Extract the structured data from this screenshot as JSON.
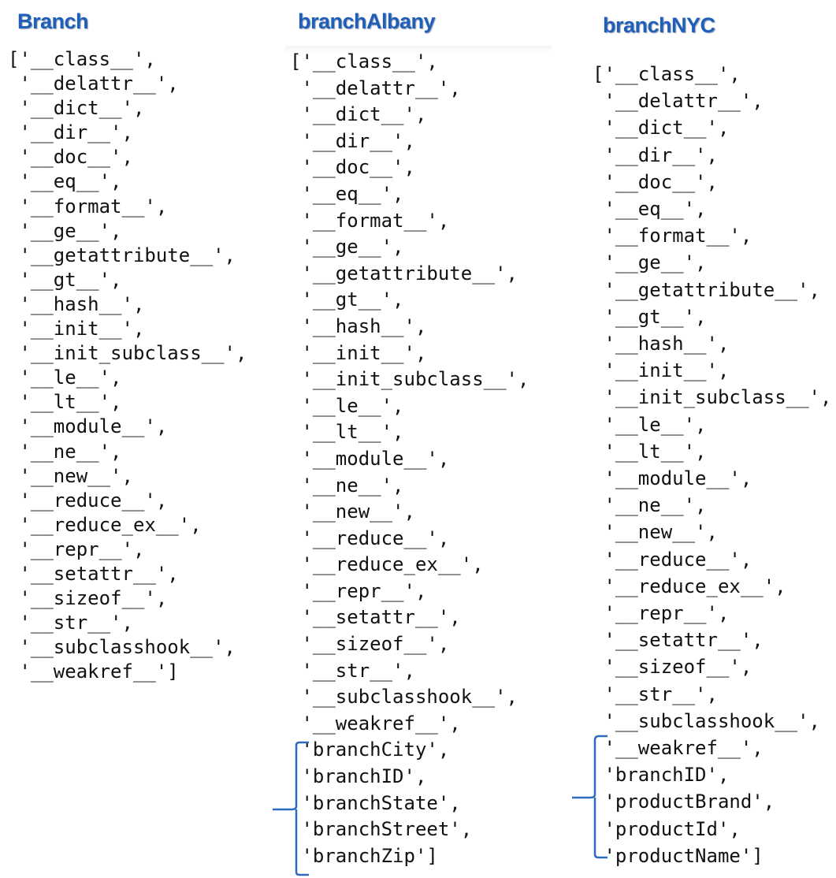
{
  "columns": [
    {
      "title": "Branch",
      "lines": [
        "['__class__',",
        " '__delattr__',",
        " '__dict__',",
        " '__dir__',",
        " '__doc__',",
        " '__eq__',",
        " '__format__',",
        " '__ge__',",
        " '__getattribute__',",
        " '__gt__',",
        " '__hash__',",
        " '__init__',",
        " '__init_subclass__',",
        " '__le__',",
        " '__lt__',",
        " '__module__',",
        " '__ne__',",
        " '__new__',",
        " '__reduce__',",
        " '__reduce_ex__',",
        " '__repr__',",
        " '__setattr__',",
        " '__sizeof__',",
        " '__str__',",
        " '__subclasshook__',",
        " '__weakref__']"
      ]
    },
    {
      "title": "branchAlbany",
      "lines": [
        "['__class__',",
        " '__delattr__',",
        " '__dict__',",
        " '__dir__',",
        " '__doc__',",
        " '__eq__',",
        " '__format__',",
        " '__ge__',",
        " '__getattribute__',",
        " '__gt__',",
        " '__hash__',",
        " '__init__',",
        " '__init_subclass__',",
        " '__le__',",
        " '__lt__',",
        " '__module__',",
        " '__ne__',",
        " '__new__',",
        " '__reduce__',",
        " '__reduce_ex__',",
        " '__repr__',",
        " '__setattr__',",
        " '__sizeof__',",
        " '__str__',",
        " '__subclasshook__',",
        " '__weakref__',",
        " 'branchCity',",
        " 'branchID',",
        " 'branchState',",
        " 'branchStreet',",
        " 'branchZip']"
      ],
      "highlighted_attributes": [
        "branchCity",
        "branchID",
        "branchState",
        "branchStreet",
        "branchZip"
      ]
    },
    {
      "title": "branchNYC",
      "lines": [
        "['__class__',",
        " '__delattr__',",
        " '__dict__',",
        " '__dir__',",
        " '__doc__',",
        " '__eq__',",
        " '__format__',",
        " '__ge__',",
        " '__getattribute__',",
        " '__gt__',",
        " '__hash__',",
        " '__init__',",
        " '__init_subclass__',",
        " '__le__',",
        " '__lt__',",
        " '__module__',",
        " '__ne__',",
        " '__new__',",
        " '__reduce__',",
        " '__reduce_ex__',",
        " '__repr__',",
        " '__setattr__',",
        " '__sizeof__',",
        " '__str__',",
        " '__subclasshook__',",
        " '__weakref__',",
        " 'branchID',",
        " 'productBrand',",
        " 'productId',",
        " 'productName']"
      ],
      "highlighted_attributes": [
        "branchID",
        "productBrand",
        "productId",
        "productName"
      ]
    }
  ],
  "colors": {
    "title": "#1f5fb8",
    "bracket": "#2e6bbf",
    "code_text": "#111111"
  }
}
